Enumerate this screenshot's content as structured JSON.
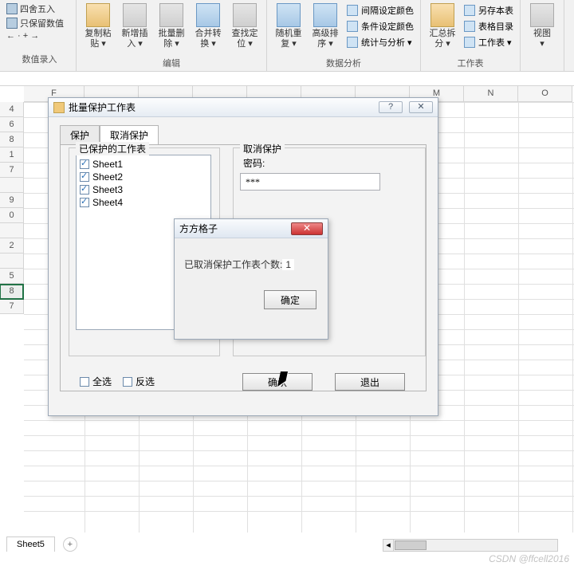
{
  "ribbon": {
    "input_group": {
      "round": "四舍五入",
      "keep_num": "只保留数值",
      "arrows": "← · + →",
      "label": "数值录入"
    },
    "edit": {
      "copy": "复制粘\n贴 ▾",
      "insert": "新增插\n入 ▾",
      "delete": "批量删\n除 ▾",
      "merge": "合并转\n换 ▾",
      "locate": "查找定\n位 ▾",
      "label": "编辑"
    },
    "data": {
      "random": "随机重\n复 ▾",
      "sort": "高级排\n序 ▾",
      "interval": "间隔设定颜色",
      "cond": "条件设定颜色",
      "stats": "统计与分析 ▾",
      "label": "数据分析"
    },
    "sheet": {
      "split": "汇总拆\n分 ▾",
      "saveas": "另存本表",
      "toc": "表格目录",
      "ws": "工作表 ▾",
      "label": "工作表"
    },
    "view": {
      "view": "视图\n▾"
    }
  },
  "namebox": "",
  "grid": {
    "cols": [
      "F",
      "",
      "",
      "",
      "",
      "",
      "",
      "M",
      "N",
      "O"
    ],
    "rows": [
      "4",
      "6",
      "8",
      "1",
      "7",
      "",
      "9",
      "0",
      "",
      "2",
      "",
      "5",
      "8",
      "7"
    ]
  },
  "dialog1": {
    "title": "批量保护工作表",
    "help": "?",
    "close": "✕",
    "tabs": {
      "protect": "保护",
      "unprotect": "取消保护"
    },
    "left_legend": "已保护的工作表",
    "sheets": [
      "Sheet1",
      "Sheet2",
      "Sheet3",
      "Sheet4"
    ],
    "right_legend": "取消保护",
    "pw_label": "密码:",
    "pw_value": "***",
    "select_all": "全选",
    "invert": "反选",
    "ok": "确认",
    "exit": "退出"
  },
  "dialog2": {
    "title": "方方格子",
    "message_prefix": "已取消保护工作表个数:",
    "count": "1",
    "ok": "确定"
  },
  "tabstrip": {
    "tab": "Sheet5",
    "add": "+"
  },
  "watermark": "CSDN @ffcell2016"
}
